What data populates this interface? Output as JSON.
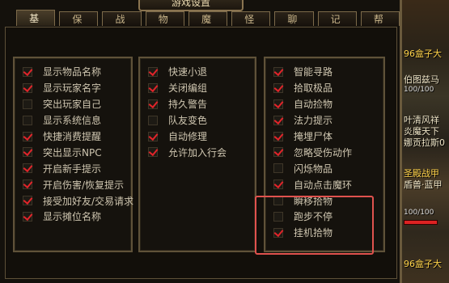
{
  "dialog": {
    "title": "游戏设置",
    "tabs": [
      {
        "label": "基本",
        "active": true
      },
      {
        "label": "保护",
        "active": false
      },
      {
        "label": "战斗",
        "active": false
      },
      {
        "label": "物品",
        "active": false
      },
      {
        "label": "魔法",
        "active": false
      },
      {
        "label": "怪物",
        "active": false
      },
      {
        "label": "聊天",
        "active": false
      },
      {
        "label": "记录",
        "active": false
      },
      {
        "label": "帮助",
        "active": false
      }
    ]
  },
  "columns": [
    {
      "items": [
        {
          "label": "显示物品名称",
          "checked": true
        },
        {
          "label": "显示玩家名字",
          "checked": true
        },
        {
          "label": "突出玩家自己",
          "checked": false
        },
        {
          "label": "显示系统信息",
          "checked": false
        },
        {
          "label": "快捷消费提醒",
          "checked": true
        },
        {
          "label": "突出显示NPC",
          "checked": true
        },
        {
          "label": "开启新手提示",
          "checked": true
        },
        {
          "label": "开启伤害/恢复提示",
          "checked": true
        },
        {
          "label": "接受加好友/交易请求",
          "checked": true
        },
        {
          "label": "显示摊位名称",
          "checked": true
        }
      ]
    },
    {
      "items": [
        {
          "label": "快速小退",
          "checked": true
        },
        {
          "label": "关闭编组",
          "checked": true
        },
        {
          "label": "持久警告",
          "checked": true
        },
        {
          "label": "队友变色",
          "checked": false
        },
        {
          "label": "自动修理",
          "checked": true
        },
        {
          "label": "允许加入行会",
          "checked": true
        }
      ]
    },
    {
      "items": [
        {
          "label": "智能寻路",
          "checked": true
        },
        {
          "label": "拾取极品",
          "checked": true
        },
        {
          "label": "自动捡物",
          "checked": true
        },
        {
          "label": "法力提示",
          "checked": true
        },
        {
          "label": "掩埋尸体",
          "checked": true
        },
        {
          "label": "忽略受伤动作",
          "checked": true
        },
        {
          "label": "闪烁物品",
          "checked": false
        },
        {
          "label": "自动点击魔环",
          "checked": true
        },
        {
          "label": "瞬移拾物",
          "checked": false
        },
        {
          "label": "跑步不停",
          "checked": false
        },
        {
          "label": "挂机拾物",
          "checked": true
        }
      ]
    }
  ],
  "highlight_color": "#e0524e",
  "check_color": "#e0242a",
  "scene": {
    "labels": [
      "96盒子大",
      "伯图兹马",
      "100/100",
      "叶清风祥",
      "炎魔天下",
      "娜贡拉斯0",
      "圣殿战甲",
      "盾兽·蓝甲",
      "100/100",
      "96盒子大"
    ]
  }
}
